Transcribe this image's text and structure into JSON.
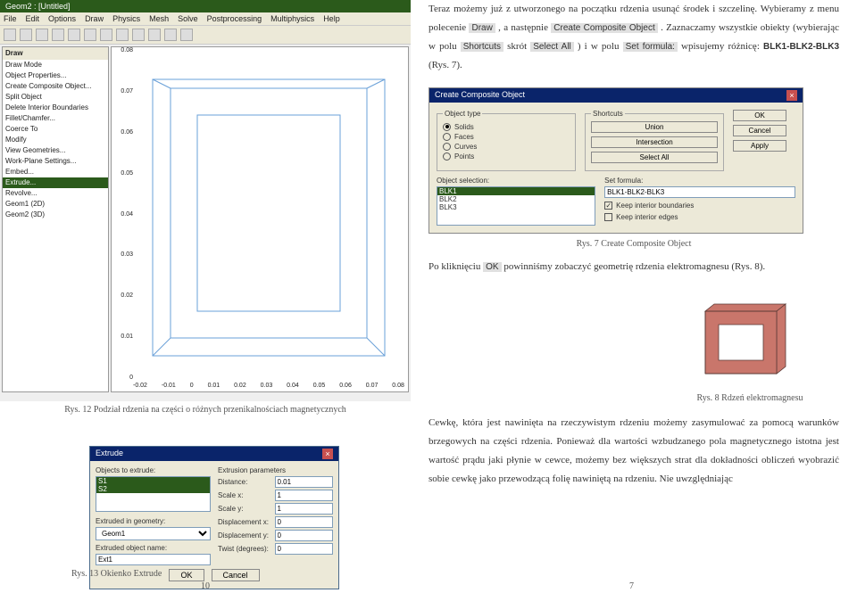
{
  "left": {
    "app_title": "Geom2 : [Untitled]",
    "menu": [
      "File",
      "Edit",
      "Options",
      "Draw",
      "Physics",
      "Mesh",
      "Solve",
      "Postprocessing",
      "Multiphysics",
      "Help"
    ],
    "tree_header": "Draw",
    "tree_items": [
      "Draw Mode",
      "Object Properties...",
      "Create Composite Object...",
      "Split Object",
      "Delete Interior Boundaries",
      "Fillet/Chamfer...",
      "Coerce To",
      "Modify",
      "View Geometries...",
      "Work-Plane Settings...",
      "Embed...",
      "Extrude...",
      "Revolve...",
      "Geom1 (2D)",
      "Geom2 (3D)"
    ],
    "tree_selected_index": 11,
    "y_ticks": [
      "0.08",
      "0.07",
      "0.06",
      "0.05",
      "0.04",
      "0.03",
      "0.02",
      "0.01",
      "0"
    ],
    "x_ticks": [
      "-0.02",
      "-0.01",
      "0",
      "0.01",
      "0.02",
      "0.03",
      "0.04",
      "0.05",
      "0.06",
      "0.07",
      "0.08"
    ],
    "fig_caption": "Rys. 12 Podział rdzenia na części o różnych przenikalnościach magnetycznych",
    "extrude": {
      "title": "Extrude",
      "objects_label": "Objects to extrude:",
      "objects": [
        "S1",
        "S2"
      ],
      "params_label": "Extrusion parameters",
      "distance_label": "Distance:",
      "distance": "0.01",
      "scalex_label": "Scale x:",
      "scalex": "1",
      "scaley_label": "Scale y:",
      "scaley": "1",
      "dispx_label": "Displacement x:",
      "dispx": "0",
      "dispy_label": "Displacement y:",
      "dispy": "0",
      "twist_label": "Twist (degrees):",
      "twist": "0",
      "geom_label": "Extruded in geometry:",
      "geom": "Geom1",
      "name_label": "Extruded object name:",
      "name": "Ext1",
      "ok": "OK",
      "cancel": "Cancel"
    },
    "extrude_caption": "Rys. 13 Okienko Extrude",
    "page_num": "10"
  },
  "right": {
    "p1_a": "Teraz możemy już z utworzonego na początku rdzenia usunąć środek i szczelinę. Wybieramy z menu polecenie ",
    "p1_draw": "Draw",
    "p1_b": ", a następnie ",
    "p1_cco": "Create Composite Object",
    "p1_c": ". Zaznaczamy wszystkie obiekty (wybierając w polu ",
    "p1_sc": "Shortcuts",
    "p1_d": " skrót ",
    "p1_sa": "Select All",
    "p1_e": " ) i w polu ",
    "p1_sf": "Set formula:",
    "p1_f": " wpisujemy różnicę: ",
    "p1_blk": "BLK1-BLK2-BLK3",
    "p1_g": " (Rys. 7).",
    "cco": {
      "title": "Create Composite Object",
      "obj_type": "Object type",
      "solids": "Solids",
      "faces": "Faces",
      "curves": "Curves",
      "points": "Points",
      "shortcuts": "Shortcuts",
      "union": "Union",
      "intersection": "Intersection",
      "select_all": "Select All",
      "ok": "OK",
      "cancel": "Cancel",
      "apply": "Apply",
      "obj_sel": "Object selection:",
      "list": [
        "BLK1",
        "BLK2",
        "BLK3"
      ],
      "set_formula": "Set formula:",
      "formula": "BLK1-BLK2-BLK3",
      "keep_bound": "Keep interior boundaries",
      "keep_edges": "Keep interior edges"
    },
    "cco_caption": "Rys. 7 Create Composite Object",
    "p2_a": "Po kliknięciu ",
    "p2_ok": "OK",
    "p2_b": " powinniśmy zobaczyć geometrię rdzenia elektromagnesu (Rys. 8).",
    "fig3d_caption": "Rys. 8 Rdzeń elektromagnesu",
    "p3": "Cewkę, która jest nawinięta na rzeczywistym rdzeniu możemy zasymulować za pomocą warunków brzegowych na części rdzenia. Ponieważ dla wartości wzbudzanego pola magnetycznego istotna jest wartość prądu jaki płynie w cewce, możemy bez większych strat dla dokładności obliczeń wyobrazić sobie cewkę jako przewodzącą folię nawiniętą na rdzeniu. Nie uwzględniając",
    "page_num": "7"
  }
}
